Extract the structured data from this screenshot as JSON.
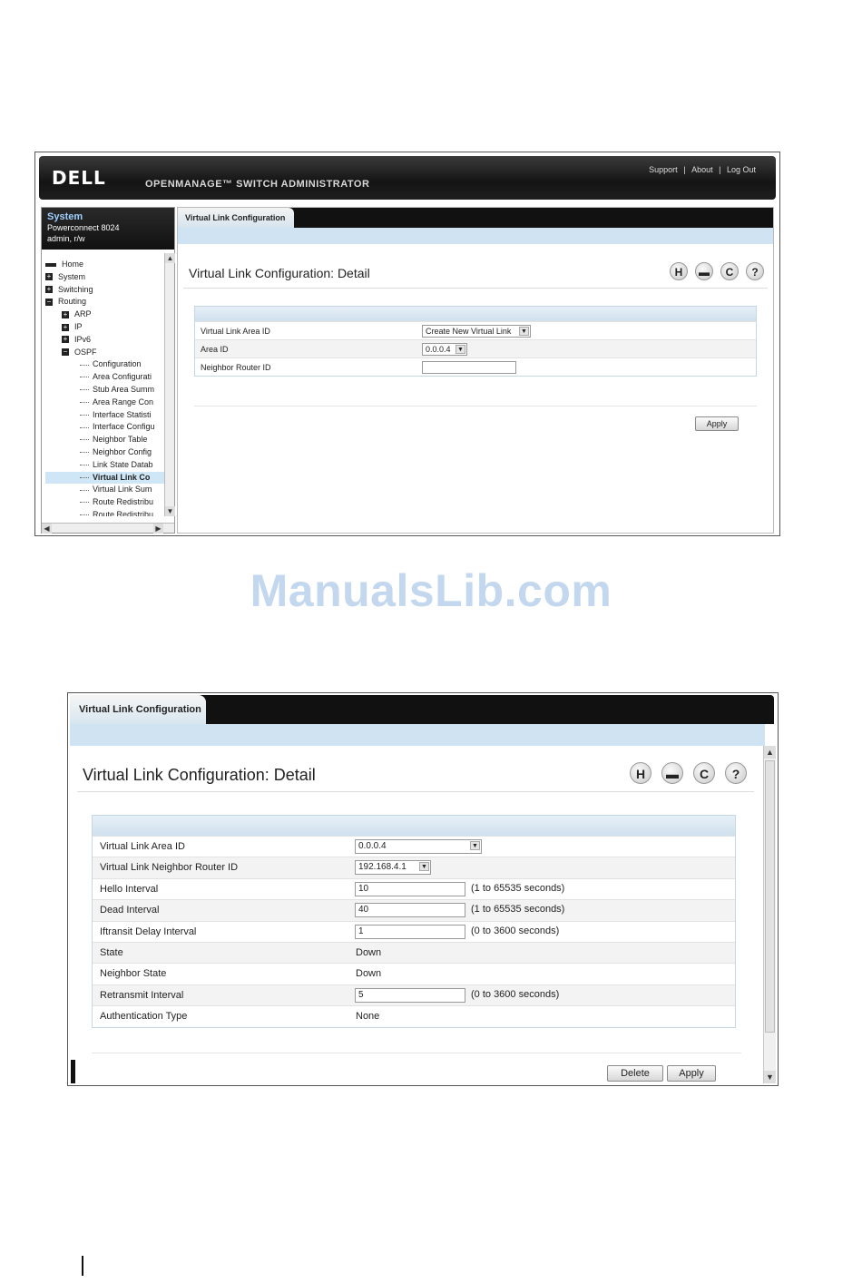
{
  "screen1": {
    "brand": "DELL",
    "product": "OPENMANAGE™ SWITCH ADMINISTRATOR",
    "top_links": [
      "Support",
      "About",
      "Log Out"
    ],
    "top_link_sep": "|",
    "system": {
      "title": "System",
      "model": "Powerconnect 8024",
      "user": "admin, r/w"
    },
    "tree": [
      {
        "label": "Home",
        "level": 0,
        "expander": "home"
      },
      {
        "label": "System",
        "level": 0,
        "expander": "+"
      },
      {
        "label": "Switching",
        "level": 0,
        "expander": "+"
      },
      {
        "label": "Routing",
        "level": 0,
        "expander": "-"
      },
      {
        "label": "ARP",
        "level": 1,
        "expander": "+"
      },
      {
        "label": "IP",
        "level": 1,
        "expander": "+"
      },
      {
        "label": "IPv6",
        "level": 1,
        "expander": "+"
      },
      {
        "label": "OSPF",
        "level": 1,
        "expander": "-"
      },
      {
        "label": "Configuration",
        "level": 2
      },
      {
        "label": "Area Configurati",
        "level": 2
      },
      {
        "label": "Stub Area Summ",
        "level": 2
      },
      {
        "label": "Area Range Con",
        "level": 2
      },
      {
        "label": "Interface Statisti",
        "level": 2
      },
      {
        "label": "Interface Configu",
        "level": 2
      },
      {
        "label": "Neighbor Table",
        "level": 2
      },
      {
        "label": "Neighbor Config",
        "level": 2
      },
      {
        "label": "Link State Datab",
        "level": 2
      },
      {
        "label": "Virtual Link Co",
        "level": 2,
        "selected": true
      },
      {
        "label": "Virtual Link Sum",
        "level": 2
      },
      {
        "label": "Route Redistribu",
        "level": 2
      },
      {
        "label": "Route Redistribu",
        "level": 2
      }
    ],
    "tab": "Virtual Link Configuration",
    "title": "Virtual Link Configuration: Detail",
    "icons": [
      "save-icon",
      "print-icon",
      "refresh-icon",
      "help-icon"
    ],
    "icon_glyphs": [
      "H",
      "▬",
      "C",
      "?"
    ],
    "rows": [
      {
        "label": "Virtual Link Area ID",
        "value": "Create New Virtual Link"
      },
      {
        "label": "Area ID",
        "value": "0.0.0.4"
      },
      {
        "label": "Neighbor Router ID",
        "value": ""
      }
    ],
    "apply": "Apply"
  },
  "watermark": "ManualsLib.com",
  "screen2": {
    "tab": "Virtual Link Configuration",
    "title": "Virtual Link Configuration: Detail",
    "rows": [
      {
        "label": "Virtual Link Area ID",
        "value": "0.0.0.4"
      },
      {
        "label": "Virtual Link Neighbor Router ID",
        "value": "192.168.4.1"
      },
      {
        "label": "Hello Interval",
        "value": "10",
        "hint": "(1 to 65535 seconds)"
      },
      {
        "label": "Dead Interval",
        "value": "40",
        "hint": "(1 to 65535 seconds)"
      },
      {
        "label": "Iftransit Delay Interval",
        "value": "1",
        "hint": "(0 to 3600 seconds)"
      },
      {
        "label": "State",
        "value": "Down"
      },
      {
        "label": "Neighbor State",
        "value": "Down"
      },
      {
        "label": "Retransmit Interval",
        "value": "5",
        "hint": "(0 to 3600 seconds)"
      },
      {
        "label": "Authentication Type",
        "value": "None"
      }
    ],
    "delete": "Delete",
    "apply": "Apply"
  },
  "colors": {
    "header_dark": "#141414",
    "tab_band": "#cfe3f2",
    "selected_tree": "#cfe6f7",
    "watermark": "#c3d8ee"
  }
}
